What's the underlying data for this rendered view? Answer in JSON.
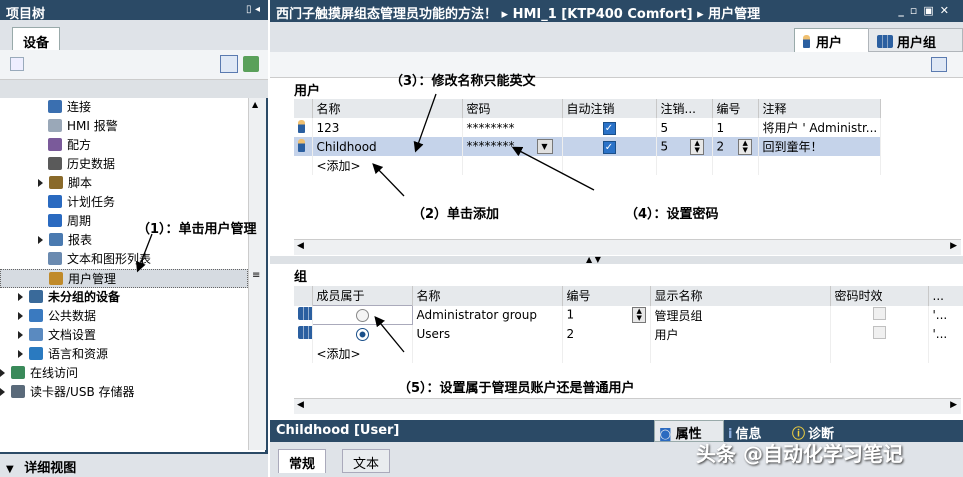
{
  "left_panel": {
    "title": "项目树",
    "tab": "设备",
    "tree": [
      {
        "label": "连接",
        "indent": 3,
        "icon": "connection-icon",
        "color": "#3a6fb0",
        "arrow": false,
        "bold": false
      },
      {
        "label": "HMI 报警",
        "indent": 3,
        "icon": "alarm-envelope-icon",
        "color": "#9aa8b8",
        "arrow": false,
        "bold": false
      },
      {
        "label": "配方",
        "indent": 3,
        "icon": "recipe-icon",
        "color": "#7a5a9a",
        "arrow": false,
        "bold": false
      },
      {
        "label": "历史数据",
        "indent": 3,
        "icon": "archive-icon",
        "color": "#5a5a5a",
        "arrow": false,
        "bold": false
      },
      {
        "label": "脚本",
        "indent": 3,
        "icon": "script-icon",
        "color": "#8a6a2a",
        "arrow": true,
        "bold": false
      },
      {
        "label": "计划任务",
        "indent": 3,
        "icon": "scheduler-icon",
        "color": "#2a6ac0",
        "arrow": false,
        "bold": false
      },
      {
        "label": "周期",
        "indent": 3,
        "icon": "cycle-icon",
        "color": "#2a6ac0",
        "arrow": false,
        "bold": false
      },
      {
        "label": "报表",
        "indent": 3,
        "icon": "report-icon",
        "color": "#4a7ab0",
        "arrow": true,
        "bold": false
      },
      {
        "label": "文本和图形列表",
        "indent": 3,
        "icon": "text-graphic-list-icon",
        "color": "#6a8ab0",
        "arrow": false,
        "bold": false
      },
      {
        "label": "用户管理",
        "indent": 3,
        "icon": "user-admin-icon",
        "color": "#c08a2a",
        "arrow": false,
        "bold": false,
        "selected": true
      },
      {
        "label": "未分组的设备",
        "indent": 2,
        "icon": "ungrouped-devices-icon",
        "color": "#3a6a9a",
        "arrow": true,
        "bold": true
      },
      {
        "label": "公共数据",
        "indent": 2,
        "icon": "common-data-icon",
        "color": "#3a7ac0",
        "arrow": true,
        "bold": false
      },
      {
        "label": "文档设置",
        "indent": 2,
        "icon": "document-settings-icon",
        "color": "#5a8ac0",
        "arrow": true,
        "bold": false
      },
      {
        "label": "语言和资源",
        "indent": 2,
        "icon": "language-resources-icon",
        "color": "#2a7ac0",
        "arrow": true,
        "bold": false
      },
      {
        "label": "在线访问",
        "indent": 1,
        "icon": "online-access-icon",
        "color": "#3a8a5a",
        "arrow": true,
        "bold": false
      },
      {
        "label": "读卡器/USB 存储器",
        "indent": 1,
        "icon": "card-reader-icon",
        "color": "#5a6a7a",
        "arrow": true,
        "bold": false
      }
    ],
    "detail_title": "详细视图"
  },
  "editor": {
    "breadcrumb": "西门子触摸屏组态管理员功能的方法！ ▸ HMI_1 [KTP400 Comfort] ▸ 用户管理",
    "tabs": [
      "用户",
      "用户组"
    ],
    "users_section": "用户",
    "users_columns": [
      "名称",
      "密码",
      "自动注销",
      "注销...",
      "编号",
      "注释"
    ],
    "users": [
      {
        "name": "123",
        "password": "********",
        "auto_logoff": true,
        "logoff_time": "5",
        "number": "1",
        "comment": "将用户 ' Administr..."
      },
      {
        "name": "Childhood",
        "password": "********",
        "auto_logoff": true,
        "logoff_time": "5",
        "number": "2",
        "comment": "回到童年！"
      }
    ],
    "add_label": "<添加>",
    "groups_section": "组",
    "groups_columns": [
      "成员属于",
      "名称",
      "编号",
      "显示名称",
      "密码时效",
      "..."
    ],
    "groups": [
      {
        "member": false,
        "name": "Administrator group",
        "number": "1",
        "display": "管理员组",
        "tail": "'..."
      },
      {
        "member": true,
        "name": "Users",
        "number": "2",
        "display": "用户",
        "tail": "'..."
      }
    ],
    "group_add_label": "<添加>"
  },
  "annotations": {
    "a1": "（1）：单击用户管理",
    "a2": "（2）单击添加",
    "a3": "（3）：修改名称只能英文",
    "a4": "（4）：设置密码",
    "a5": "（5）：设置属于管理员账户还是普通用户"
  },
  "bottom": {
    "title": "Childhood [User]",
    "tabs_right": [
      "属性",
      "信息",
      "诊断"
    ],
    "tabs": [
      "常规",
      "文本"
    ],
    "watermark": "头条 @自动化学习笔记"
  }
}
